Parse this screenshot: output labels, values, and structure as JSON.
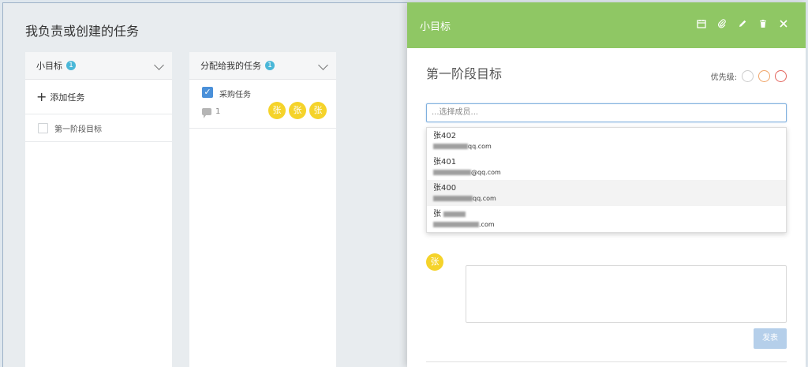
{
  "page": {
    "title": "我负责或创建的任务"
  },
  "columns": [
    {
      "title": "小目标",
      "badge": "1",
      "add_task_label": "添加任务",
      "goals": [
        {
          "label": "第一阶段目标",
          "checked": false
        }
      ]
    },
    {
      "title": "分配给我的任务",
      "badge": "1",
      "tasks": [
        {
          "name": "采购任务",
          "checked": true,
          "comments": "1",
          "avatars": [
            "张",
            "张",
            "张"
          ]
        }
      ]
    }
  ],
  "panel": {
    "header_title": "小目标",
    "header_icons": [
      "calendar-icon",
      "attachment-icon",
      "edit-icon",
      "trash-icon",
      "close-icon"
    ],
    "goal_title": "第一阶段目标",
    "priority_label": "优先级:",
    "priority_colors": [
      "#cccccc",
      "#f0a467",
      "#e2635b"
    ],
    "member_placeholder": "...选择成员...",
    "dropdown_options": [
      {
        "name": "张402",
        "email_suffix": "qq.com"
      },
      {
        "name": "张401",
        "email_suffix": "@qq.com"
      },
      {
        "name": "张400",
        "email_suffix": "qq.com"
      },
      {
        "name": "张",
        "email_suffix": ".com"
      }
    ],
    "assignee_avatar": "张",
    "submit_label": "发表"
  },
  "colors": {
    "header_green": "#8fc764",
    "checkbox_blue": "#4a90d9",
    "avatar_yellow": "#f5d32a",
    "badge_blue": "#4ab7d8"
  }
}
